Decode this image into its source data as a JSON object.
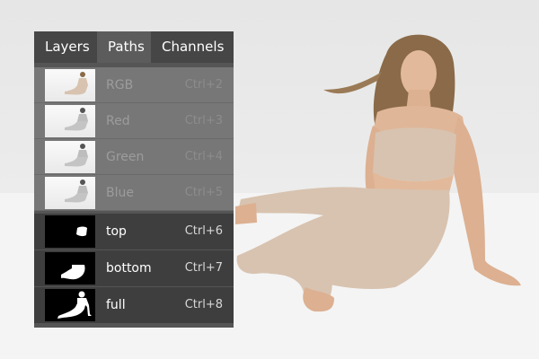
{
  "tabs": [
    {
      "label": "Layers",
      "active": false
    },
    {
      "label": "Paths",
      "active": true
    },
    {
      "label": "Channels",
      "active": false
    }
  ],
  "channels": [
    {
      "label": "RGB",
      "shortcut": "Ctrl+2",
      "thumbnail": "color-photo"
    },
    {
      "label": "Red",
      "shortcut": "Ctrl+3",
      "thumbnail": "grayscale-photo"
    },
    {
      "label": "Green",
      "shortcut": "Ctrl+4",
      "thumbnail": "grayscale-photo"
    },
    {
      "label": "Blue",
      "shortcut": "Ctrl+5",
      "thumbnail": "grayscale-photo"
    }
  ],
  "paths": [
    {
      "label": "top",
      "shortcut": "Ctrl+6",
      "thumbnail": "top-silhouette"
    },
    {
      "label": "bottom",
      "shortcut": "Ctrl+7",
      "thumbnail": "bottom-silhouette"
    },
    {
      "label": "full",
      "shortcut": "Ctrl+8",
      "thumbnail": "full-silhouette"
    }
  ],
  "colors": {
    "panel_bg": "#555555",
    "tab_bar": "#464646",
    "channel_row": "#777777",
    "path_row": "#3e3e3e",
    "outfit": "#d8c3b0"
  }
}
